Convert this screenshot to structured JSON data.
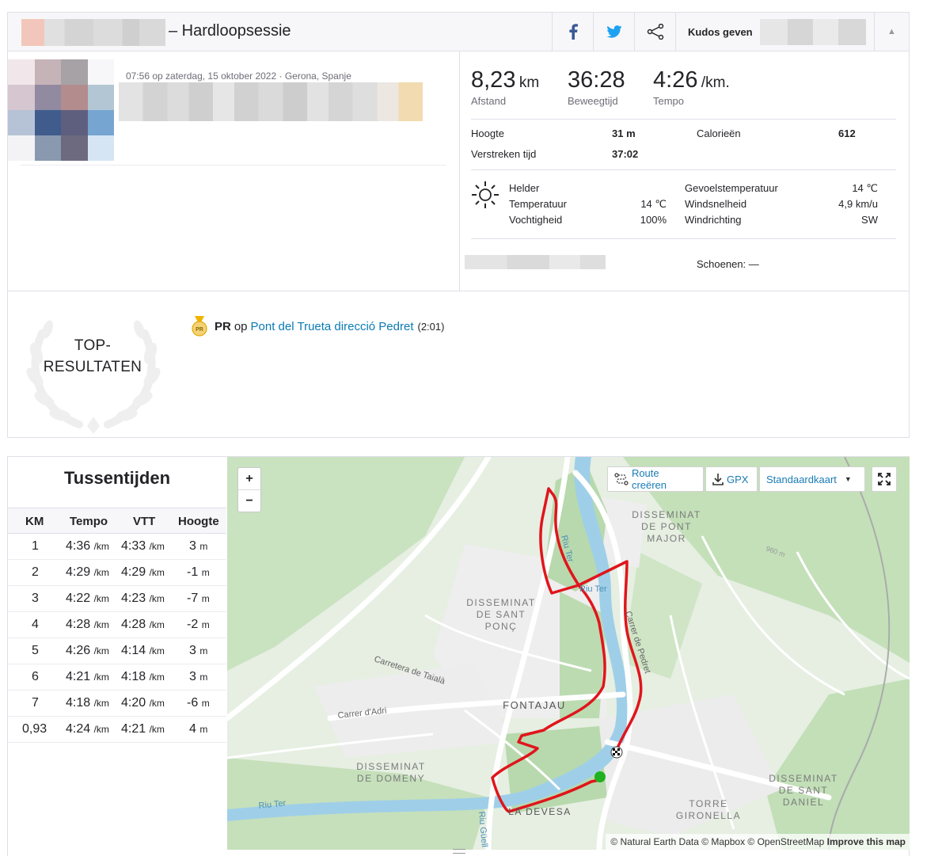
{
  "header": {
    "title": "– Hardloopsessie",
    "facebook_icon": "facebook-icon",
    "twitter_icon": "twitter-icon",
    "share_icon": "share-icon",
    "kudos_label": "Kudos geven",
    "collapse_icon": "chevron-up-icon"
  },
  "activity": {
    "meta": "07:56 op zaterdag, 15 oktober 2022 · Gerona, Spanje"
  },
  "stats": {
    "distance": {
      "value": "8,23",
      "unit": "km",
      "label": "Afstand"
    },
    "moving_time": {
      "value": "36:28",
      "label": "Beweegtijd"
    },
    "pace": {
      "value": "4:26",
      "unit": "/km.",
      "label": "Tempo"
    },
    "elevation_label": "Hoogte",
    "elevation_value": "31 m",
    "calories_label": "Calorieën",
    "calories_value": "612",
    "elapsed_label": "Verstreken tijd",
    "elapsed_value": "37:02"
  },
  "weather": {
    "icon": "sun-icon",
    "condition": "Helder",
    "temperature_label": "Temperatuur",
    "temperature_value": "14 ℃",
    "humidity_label": "Vochtigheid",
    "humidity_value": "100%",
    "feels_label": "Gevoelstemperatuur",
    "feels_value": "14 ℃",
    "wind_speed_label": "Windsnelheid",
    "wind_speed_value": "4,9 km/u",
    "wind_dir_label": "Windrichting",
    "wind_dir_value": "SW"
  },
  "shoes": {
    "label": "Schoenen: —"
  },
  "top_results": {
    "title_line1": "TOP-",
    "title_line2": "RESULTATEN",
    "pr_badge": "PR",
    "pr_label": "PR",
    "op": "op",
    "segment": "Pont del Trueta direcció Pedret",
    "time": "(2:01)"
  },
  "splits": {
    "title": "Tussentijden",
    "headers": [
      "KM",
      "Tempo",
      "VTT",
      "Hoogte"
    ],
    "pace_unit": "/km",
    "elev_unit": "m",
    "rows": [
      {
        "km": "1",
        "pace": "4:36",
        "vtt": "4:33",
        "elev": "3"
      },
      {
        "km": "2",
        "pace": "4:29",
        "vtt": "4:29",
        "elev": "-1"
      },
      {
        "km": "3",
        "pace": "4:22",
        "vtt": "4:23",
        "elev": "-7"
      },
      {
        "km": "4",
        "pace": "4:28",
        "vtt": "4:28",
        "elev": "-2"
      },
      {
        "km": "5",
        "pace": "4:26",
        "vtt": "4:14",
        "elev": "3"
      },
      {
        "km": "6",
        "pace": "4:21",
        "vtt": "4:18",
        "elev": "3"
      },
      {
        "km": "7",
        "pace": "4:18",
        "vtt": "4:20",
        "elev": "-6"
      },
      {
        "km": "0,93",
        "pace": "4:24",
        "vtt": "4:21",
        "elev": "4"
      }
    ]
  },
  "map": {
    "zoom_in": "+",
    "zoom_out": "−",
    "route_create": "Route creëren",
    "gpx": "GPX",
    "map_style": "Standaardkaart",
    "fullscreen_icon": "fullscreen-icon",
    "attribution": "© Natural Earth Data © Mapbox © OpenStreetMap",
    "improve": "Improve this map",
    "labels": {
      "pont_major_1": "DISSEMINAT",
      "pont_major_2": "DE PONT",
      "pont_major_3": "MAJOR",
      "sant_ponc_1": "DISSEMINAT",
      "sant_ponc_2": "DE SANT",
      "sant_ponc_3": "PONÇ",
      "fontajau": "FONTAJAU",
      "domeny_1": "DISSEMINAT",
      "domeny_2": "DE DOMENY",
      "sant_daniel_1": "DISSEMINAT",
      "sant_daniel_2": "DE SANT",
      "sant_daniel_3": "DANIEL",
      "torre_1": "TORRE",
      "torre_2": "GIRONELLA",
      "devesa": "LA DEVESA",
      "talala": "Carretera de Taialà",
      "adri": "Carrer d'Adri",
      "riu_ter": "Riu Ter",
      "riu_ter2": "Riu Ter",
      "riu_ter3": "Riu Ter",
      "guell": "Riu Güell",
      "carrer_pedret": "Carrer de Pedret",
      "elev": "960 m"
    },
    "colors": {
      "route": "#e0151c",
      "water": "#9fcfe8",
      "park": "#b8d9ad",
      "road": "#ffffff"
    }
  }
}
